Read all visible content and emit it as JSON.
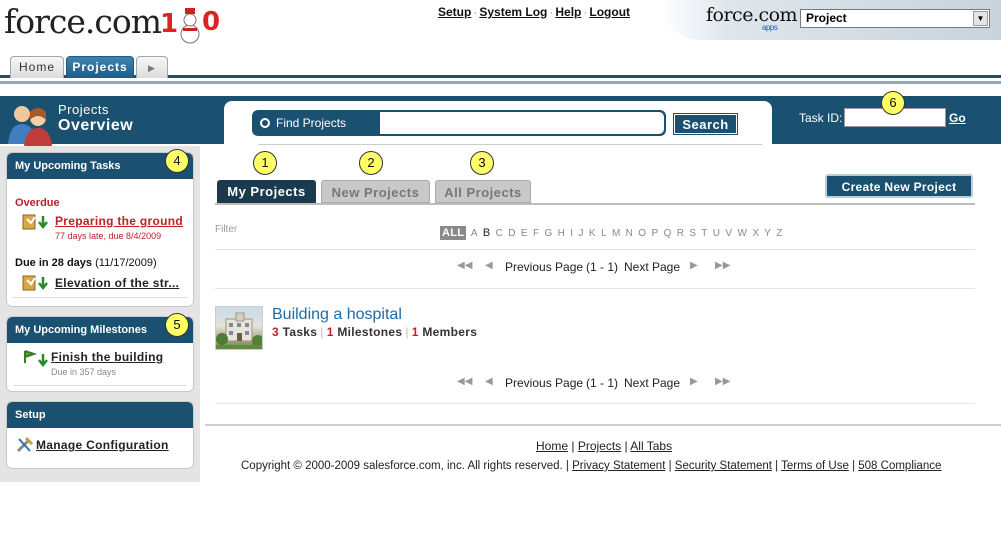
{
  "header": {
    "logo_text": "force.com",
    "top_links": [
      "Setup",
      "System Log",
      "Help",
      "Logout"
    ],
    "brand_text": "force.com",
    "brand_sub": "apps",
    "app_selector_value": "Project"
  },
  "tabs": [
    {
      "label": "Home",
      "active": false
    },
    {
      "label": "Projects",
      "active": true
    }
  ],
  "page_header": {
    "title_small": "Projects",
    "title_big": "Overview",
    "search_label": "Find Projects",
    "search_value": "",
    "search_button": "Search",
    "task_id_label": "Task ID:",
    "task_id_value": "",
    "go_button": "Go"
  },
  "sidebar": {
    "tasks": {
      "title": "My Upcoming Tasks",
      "overdue_label": "Overdue",
      "overdue_item": {
        "name": "Preparing the ground",
        "detail": "77 days late, due 8/4/2009"
      },
      "due_label": "Due in 28 days",
      "due_date": "(11/17/2009)",
      "due_item": {
        "name": "Elevation of the str..."
      }
    },
    "milestones": {
      "title": "My Upcoming Milestones",
      "item": {
        "name": "Finish the building",
        "detail": "Due in 357 days"
      }
    },
    "setup": {
      "title": "Setup",
      "item": "Manage Configuration"
    }
  },
  "main": {
    "tabs": [
      {
        "label": "My Projects",
        "active": true
      },
      {
        "label": "New Projects",
        "active": false
      },
      {
        "label": "All Projects",
        "active": false
      }
    ],
    "create_button": "Create New Project",
    "filter_label": "Filter",
    "alphabet": [
      "ALL",
      "A",
      "B",
      "C",
      "D",
      "E",
      "F",
      "G",
      "H",
      "I",
      "J",
      "K",
      "L",
      "M",
      "N",
      "O",
      "P",
      "Q",
      "R",
      "S",
      "T",
      "U",
      "V",
      "W",
      "X",
      "Y",
      "Z"
    ],
    "pager": {
      "prev": "Previous Page",
      "range": "(1 - 1)",
      "next": "Next Page"
    },
    "project": {
      "name": "Building a hospital",
      "tasks_count": "3",
      "tasks_label": "Tasks",
      "milestones_count": "1",
      "milestones_label": "Milestones",
      "members_count": "1",
      "members_label": "Members"
    }
  },
  "footer": {
    "nav": [
      "Home",
      "Projects",
      "All Tabs"
    ],
    "copyright": "Copyright © 2000-2009 salesforce.com, inc. All rights reserved.",
    "links": [
      "Privacy Statement",
      "Security Statement",
      "Terms of Use",
      "508 Compliance"
    ]
  },
  "callouts": [
    "1",
    "2",
    "3",
    "4",
    "5",
    "6"
  ],
  "colors": {
    "accent": "#1b5170",
    "overdue": "#c0202a",
    "link": "#1f6aa5",
    "callout": "#ffff66"
  }
}
